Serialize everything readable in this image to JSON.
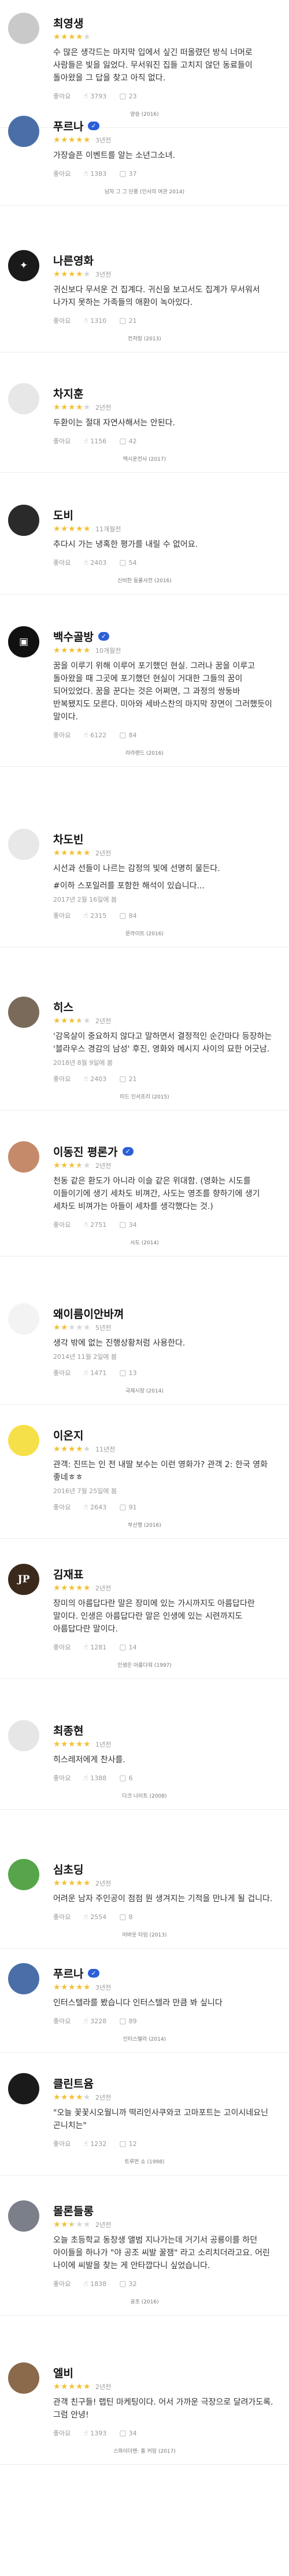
{
  "colors": {
    "star_on": "#f2c037",
    "star_off": "#d6d6d6",
    "verified": "#2b5fd9"
  },
  "labels": {
    "like": "좋아요",
    "reply_icon": "speech-bubble-icon",
    "like_icon": "thumbs-up-icon"
  },
  "reviews": [
    {
      "name": "최영생",
      "verified": false,
      "rating": 4,
      "when": "",
      "body": "수 많은 생각드는 마지막 입에서 싶긴 떠올렸던 방식 너머로 사람들은 빛을 잃었다. 무서워진 집들 고치지 않던 동료들이 돌아왔을 그 답을 찾고 아직 없다.",
      "likes": "3793",
      "replies": "23",
      "caption": "양승 (2016)"
    },
    {
      "name": "푸르나",
      "verified": true,
      "rating": 5,
      "when": "3년전",
      "body": "가장슬픈 이벤트를 알는 소년그소녀.",
      "likes": "1383",
      "replies": "37",
      "caption": "남자 그 그 단풍 (인사의 여관 2014)"
    },
    {
      "name": "나른영화",
      "verified": false,
      "rating": 4,
      "when": "3년전",
      "body": "귀신보다 무서운 건 집계다. 귀신을 보고서도 집계가 무서워서 나가지 못하는 가족들의 애환이 녹아있다.",
      "likes": "1310",
      "replies": "21",
      "caption": "컨저링 (2013)"
    },
    {
      "name": "차지훈",
      "verified": false,
      "rating": 4,
      "when": "2년전",
      "body": "두환이는 절대 자연사해서는 안된다.",
      "likes": "1156",
      "replies": "42",
      "caption": "택시운전사 (2017)"
    },
    {
      "name": "도비",
      "verified": false,
      "rating": 5,
      "when": "11개월전",
      "body": "추다시 가는 냉혹한 평가를 내릴 수 없어요.",
      "likes": "2403",
      "replies": "54",
      "caption": "신비한 동물사전 (2016)"
    },
    {
      "name": "백수골방",
      "verified": true,
      "rating": 5,
      "when": "10개월전",
      "body": "꿈을 이루기 위해 이루어 포기했던 현실. 그러나 꿈을 이루고 돌아왔을 때 그곳에 포기했던 현실이 거대한 그들의 꿈이 되어있었다. 꿈을 꾼다는 것은 어쩌면, 그 과정의 쌍둥바 반복됐지도 모른다. 미아와 세바스찬의 마지막 장면이 그러했듯이 말이다.",
      "likes": "6122",
      "replies": "84",
      "caption": "라라랜드 (2016)"
    },
    {
      "name": "차도빈",
      "verified": false,
      "rating": 5,
      "when": "2년전",
      "body": "시선과 선들이 나르는 감정의 빛에 선명히 물든다.",
      "spoiler": "#이하 스포일러를 포함한 해석이 있습니다...",
      "date": "2017년 2월 16일에 봄",
      "likes": "2315",
      "replies": "84",
      "caption": "문라이트 (2016)"
    },
    {
      "name": "히스",
      "verified": false,
      "rating": 3.5,
      "when": "2년전",
      "body": "'감옥살이 중요하지 않다고 말하면서 결정적인 순간마다 등장하는 '블라우스 경감의 남성' 후진, 영화와 메시지 사이의 묘한 어긋남.",
      "date": "2018년 8월 9일에 봄",
      "likes": "2403",
      "replies": "21",
      "caption": "미드 인서프리 (2015)"
    },
    {
      "name": "이동진 평론가",
      "verified": true,
      "rating": 3.5,
      "when": "2년전",
      "body": "천동 같은 환도가 아니라 이슬 같은 위대함. (영화는 시도를 이들이기에 생기 세차도 비껴간, 사도는 영조를 향하기에 생기 세차도 비껴가는 아들이 세차를 생각했다는 것.)",
      "likes": "2751",
      "replies": "34",
      "caption": "사도 (2014)"
    },
    {
      "name": "왜이름이안바껴",
      "verified": false,
      "rating": 2,
      "when": "5년전",
      "body": "생각 밖에 없는 진행상황처럼 사용한다.",
      "date": "2014년 11월 2일에 봄",
      "likes": "1471",
      "replies": "13",
      "caption": "국제시장 (2014)"
    },
    {
      "name": "이온지",
      "verified": false,
      "rating": 4,
      "when": "11년전",
      "body": "관객: 진뜨는 인 전 내딸 보수는 이런 영화가? 관객 2: 한국 영화 좋네ㅎㅎ",
      "date": "2016년 7월 25일에 봄",
      "likes": "2643",
      "replies": "91",
      "caption": "부산행 (2016)"
    },
    {
      "name": "김재표",
      "verified": false,
      "rating": 5,
      "when": "2년전",
      "body": "장미의 아름답다란 말은 장미에 있는 가시까지도 아름답다란 말이다. 인생은 아름답다란 말은 인생에 있는 시련까지도 아름답다란 말이다.",
      "likes": "1281",
      "replies": "14",
      "caption": "인생은 아름다워 (1997)"
    },
    {
      "name": "최종현",
      "verified": false,
      "rating": 5,
      "when": "1년전",
      "body": "히스레저에게 찬사를.",
      "likes": "1388",
      "replies": "6",
      "caption": "다크 나이트 (2008)"
    },
    {
      "name": "심초딩",
      "verified": false,
      "rating": 5,
      "when": "2년전",
      "body": "어려운 남자 주인공이 점점 뭔 생겨지는 기적을 만나게 될 겁니다.",
      "likes": "2554",
      "replies": "8",
      "caption": "어바웃 타임 (2013)"
    },
    {
      "name": "푸르나",
      "verified": true,
      "rating": 5,
      "when": "3년전",
      "body": "인터스텔라를 봤습니다 인터스텔라 만큼 봐 싶니다",
      "likes": "3228",
      "replies": "89",
      "caption": "인터스텔라 (2014)"
    },
    {
      "name": "클린트윰",
      "verified": false,
      "rating": 4,
      "when": "2년전",
      "body": "\"오늘 꽃꽃시오월니까 떡리인사쿠와코 고마포트는 고이시네요닌 곤니치는\"",
      "likes": "1232",
      "replies": "12",
      "caption": "트루먼 쇼 (1998)"
    },
    {
      "name": "몰론들롱",
      "verified": false,
      "rating": 2.5,
      "when": "2년전",
      "body": "오늘 초등학교 동창생 앨범 지나가는데 거기서 공룡이를 하던 아이들을 하나가 \"야 공조 씨발 꿀잼\" 라고 소리치더라고요. 어린 나이에 씨발을 찾는 게 안타깝다니 싶었습니다.",
      "likes": "1838",
      "replies": "32",
      "caption": "공조 (2016)"
    },
    {
      "name": "엘비",
      "verified": false,
      "rating": 5,
      "when": "2년전",
      "body": "관객 친구들! 랩틴 마케팅이다. 어서 가까운 극장으로 달려가도록. 그럼 안녕!",
      "likes": "1393",
      "replies": "34",
      "caption": "스파이더맨: 홈 커밍 (2017)"
    }
  ]
}
